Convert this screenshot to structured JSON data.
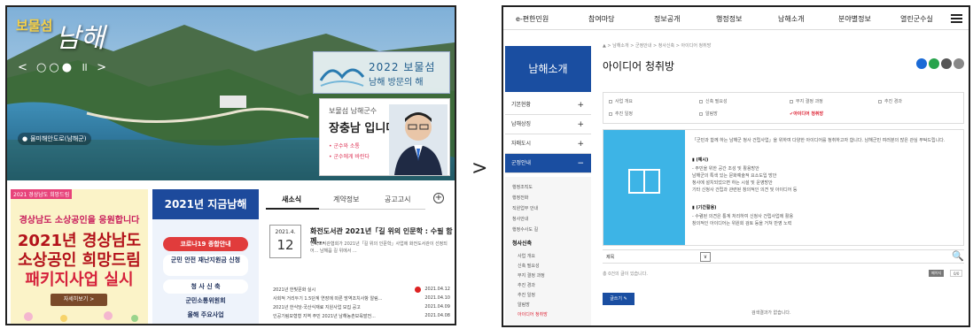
{
  "left": {
    "logo_small": "보물섬",
    "logo_large": "남해",
    "slider_controls": "< ○○● ॥ >",
    "location_caption": "물미해안도로(남해군)",
    "year_line1": "2022 보물섬",
    "year_line2": "남해 방문의 해",
    "gov_line1": "보물섬 남해군수",
    "gov_line2": "장충남 입니다",
    "gov_line3": "• 군수와 소통",
    "gov_line4": "• 군수에게 바란다",
    "ad_tag": "2021 경상남도 희망드림",
    "ad_line1": "경상남도 소상공인을 응원합니다",
    "ad_line2": "2021년 경상남도",
    "ad_line3": "소상공인 희망드림",
    "ad_line4": "패키지사업 실시",
    "ad_button": "자세히보기 >",
    "now_title": "2021년 지금남해",
    "now_buttons": [
      "코로나19 종합안내",
      "군민 안전 재난지원금 신청",
      "청 사 신 축",
      "군민소통위원회",
      "올해 주요사업"
    ],
    "tabs": [
      "새소식",
      "계약정보",
      "공고고시"
    ],
    "plus_icon": "+",
    "date_month": "2021.4.",
    "date_day": "12",
    "news_title": "화전도서관 2021년「길 위의 인문학 : 수필 함께...",
    "news_body": "한국도서관협회가 2021년「길 위의 인문학」사업에 화전도서관이 선정되어... 남해읍 길 위에서 ...",
    "news_list": [
      {
        "title": "2021년 한빛문화 실시",
        "date": "2021.04.12"
      },
      {
        "title": "사회적 거리두기 1.5단계 연장에 따른 방역조치사항 알림...",
        "date": "2021.04.10"
      },
      {
        "title": "2021년 한식당·국산식재료 지원사업 모집 공고",
        "date": "2021.04.09"
      },
      {
        "title": "인공기림모형형 지역 주민 2021년 남해농촌보육발전...",
        "date": "2021.04.08"
      }
    ]
  },
  "arrow": ">",
  "right": {
    "top_nav": [
      "e-편한민원",
      "참여마당",
      "정보공개",
      "행정정보",
      "남해소개",
      "분야별정보",
      "열린군수실"
    ],
    "sidebar_title": "남해소개",
    "sidebar_items": [
      "기본현황",
      "남해상징",
      "자매도시",
      "군정안내"
    ],
    "sub_items": [
      "행정조직도",
      "행정전화",
      "직원업무 안내",
      "청사안내",
      "행정수사도 길",
      "청사신축",
      "사업 개요",
      "신축 필요성",
      "부지 결정 과정",
      "추진 경과",
      "추진 일정",
      "알림방",
      "아이디어 청취방"
    ],
    "breadcrumb": "▲ > 남해소개 > 군정안내 > 청사신축 > 아이디어 청취방",
    "page_title": "아이디어 청취방",
    "sns_colors": [
      "#1a6ad6",
      "#27a34c",
      "#555555",
      "#888888"
    ],
    "tab_grid": [
      "사업 개요",
      "신축 필요성",
      "부지 결정 과정",
      "추진 경과",
      "추진 일정",
      "알림방",
      "아이디어 청취방"
    ],
    "info_intro": "「군민과 함께 하는 남해군 청사 건립사업」을 위하여 다양한 아이디어를 청취하고자 합니다. 남해군민 여러분의 많은 관심 부탁드립니다.",
    "info_h1": "▮ (예시)",
    "info_l1": "- 주민을 위한 공간 조성 및 활용방안",
    "info_l2": "  남해군의 특색 있는 문화예술적 요소도입 방안",
    "info_l3": "  청사에 설치되었으면 하는 시설 및 운영방안",
    "info_l4": "  기타 신청사 건립과 관련된 창의적인 의견 및 아이디어 등",
    "info_h2": "▮ (기간활용)",
    "info_l5": "- 수렴된 의견은 통계 처리하여 신청사 건립사업에 활용",
    "info_l6": "  창의적인 아이디어는 위원회 검토 등을 거쳐 반영 노력",
    "search_label": "제목",
    "select_icon": "∨",
    "search_icon": "🔍",
    "count_text": "총 0건의 글이 있습니다.",
    "page_btn1": "페이지",
    "page_btn2": "0/0",
    "write_button": "글쓰기 ✎",
    "empty_text": "검색결과가 없습니다.",
    "accent_color": "#1a4ea1"
  }
}
